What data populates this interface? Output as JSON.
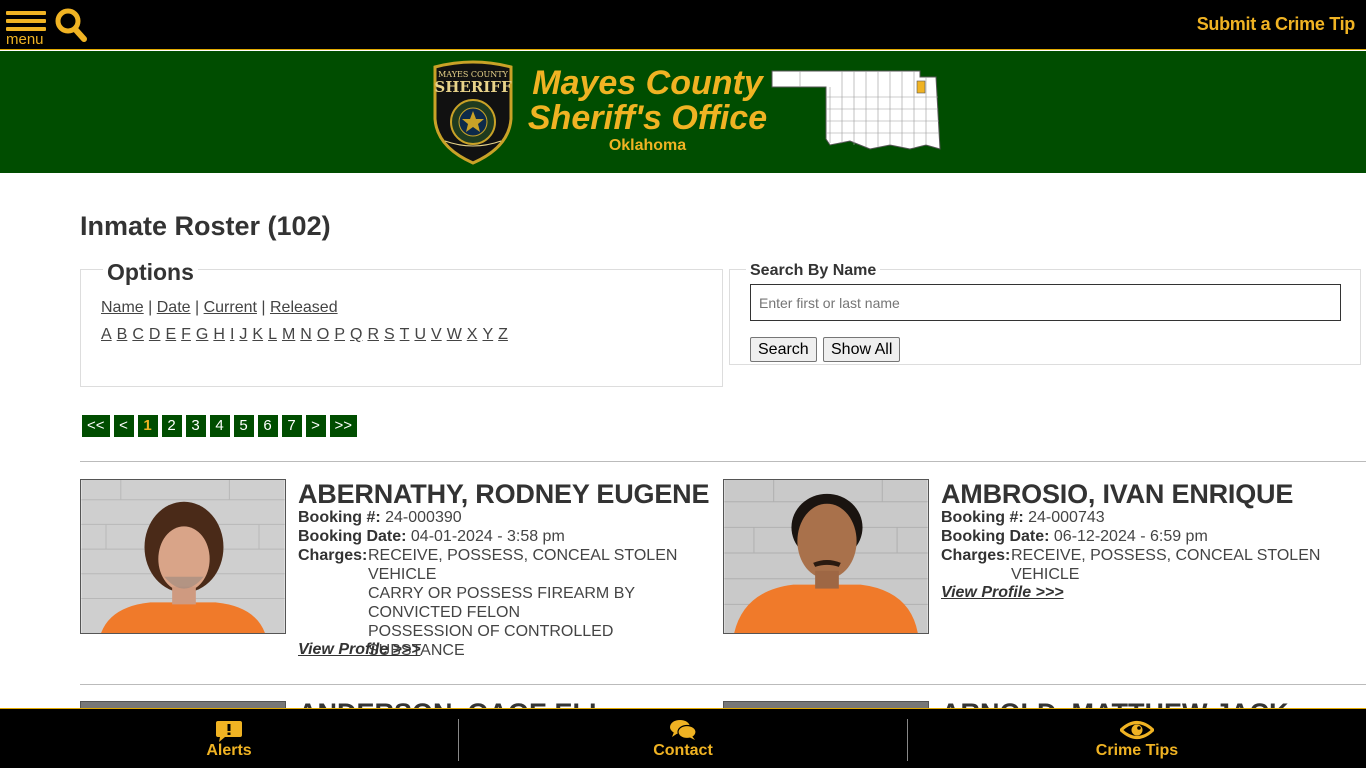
{
  "topbar": {
    "menu_label": "menu",
    "tip_link": "Submit a Crime Tip",
    "accent": "#f0b323"
  },
  "header": {
    "badge_top": "MAYES COUNTY",
    "badge_mid": "SHERIFF",
    "line1": "Mayes County",
    "line2": "Sheriff's Office",
    "state": "Oklahoma",
    "bg": "#004d00"
  },
  "page": {
    "title": "Inmate Roster (102)"
  },
  "options": {
    "legend": "Options",
    "sort_links": [
      "Name",
      "Date",
      "Current",
      "Released"
    ],
    "letters": [
      "A",
      "B",
      "C",
      "D",
      "E",
      "F",
      "G",
      "H",
      "I",
      "J",
      "K",
      "L",
      "M",
      "N",
      "O",
      "P",
      "Q",
      "R",
      "S",
      "T",
      "U",
      "V",
      "W",
      "X",
      "Y",
      "Z"
    ]
  },
  "search": {
    "legend": "Search By Name",
    "placeholder": "Enter first or last name",
    "search_label": "Search",
    "showall_label": "Show All"
  },
  "pager": {
    "first": "<<",
    "prev": "<",
    "pages": [
      "1",
      "2",
      "3",
      "4",
      "5",
      "6",
      "7"
    ],
    "current": "1",
    "next": ">",
    "last": ">>"
  },
  "inmates": [
    {
      "name": "ABERNATHY, RODNEY EUGENE",
      "booking_no_label": "Booking #:",
      "booking_no": "24-000390",
      "booking_date_label": "Booking Date:",
      "booking_date": "04-01-2024 - 3:58 pm",
      "charges_label": "Charges:",
      "charges": [
        "RECEIVE, POSSESS, CONCEAL STOLEN VEHICLE",
        "CARRY OR POSSESS FIREARM BY CONVICTED FELON",
        "POSSESSION OF CONTROLLED SUBSTANCE"
      ],
      "view_label": "View Profile >>>"
    },
    {
      "name": "AMBROSIO, IVAN ENRIQUE",
      "booking_no_label": "Booking #:",
      "booking_no": "24-000743",
      "booking_date_label": "Booking Date:",
      "booking_date": "06-12-2024 - 6:59 pm",
      "charges_label": "Charges:",
      "charges": [
        "RECEIVE, POSSESS, CONCEAL STOLEN VEHICLE"
      ],
      "view_label": "View Profile >>>"
    }
  ],
  "partial_names": [
    "ANDERSON, GAGE ELI",
    "ARNOLD, MATTHEW JACK"
  ],
  "bottom": {
    "alerts": "Alerts",
    "contact": "Contact",
    "tips": "Crime Tips"
  }
}
